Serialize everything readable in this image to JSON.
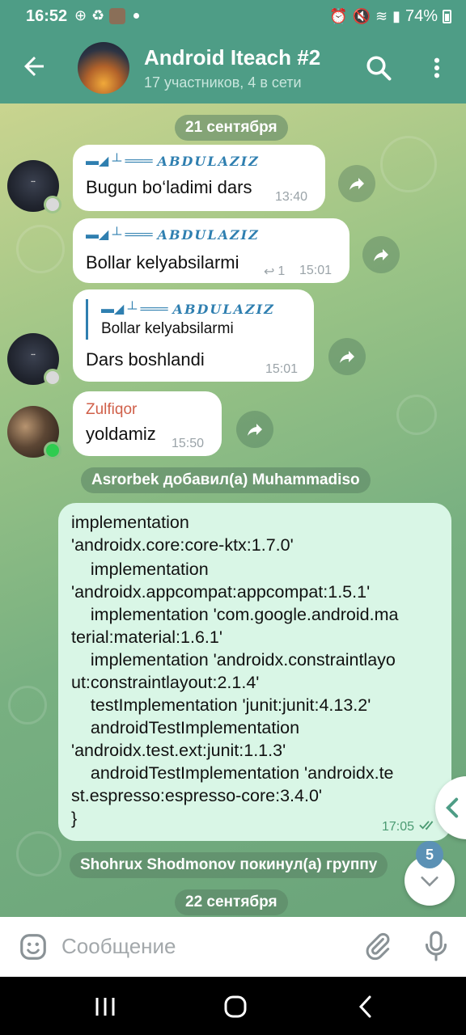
{
  "status_bar": {
    "time": "16:52",
    "battery": "74%"
  },
  "header": {
    "title": "Android Iteach #2",
    "subtitle": "17 участников, 4 в сети"
  },
  "date_pills": [
    "21 сентября",
    "22 сентября"
  ],
  "sender_tag": "▬◢ ┴ ═══",
  "sender_name": "ABDULAZIZ",
  "messages": [
    {
      "text": "Bugun bo‘ladimi dars",
      "time": "13:40"
    },
    {
      "text": "Bollar kelyabsilarmi",
      "time": "15:01",
      "reply_count": "1"
    },
    {
      "quote": "Bollar kelyabsilarmi",
      "text": "Dars boshlandi",
      "time": "15:01"
    },
    {
      "sender": "Zulfiqor",
      "text": "yoldamiz",
      "time": "15:50"
    }
  ],
  "service_messages": [
    "Asrorbek добавил(а) Muhammadiso",
    "Shohrux Shodmonov покинул(а) группу"
  ],
  "outgoing": {
    "lines": [
      "implementation",
      "'androidx.core:core-ktx:1.7.0'",
      "    implementation",
      "'androidx.appcompat:appcompat:1.5.1'",
      "    implementation 'com.google.android.ma",
      "terial:material:1.6.1'",
      "    implementation 'androidx.constraintlayo",
      "ut:constraintlayout:2.1.4'",
      "    testImplementation 'junit:junit:4.13.2'",
      "    androidTestImplementation",
      "'androidx.test.ext:junit:1.1.3'",
      "    androidTestImplementation 'androidx.te",
      "st.espresso:espresso-core:3.4.0'",
      "}"
    ],
    "time": "17:05"
  },
  "unread_badge": "5",
  "input": {
    "placeholder": "Сообщение"
  },
  "colors": {
    "header": "#4e9d86",
    "outgoing_bubble": "#d9f6e6",
    "link_blue": "#2f7fb0",
    "sender_red": "#d0604a"
  }
}
